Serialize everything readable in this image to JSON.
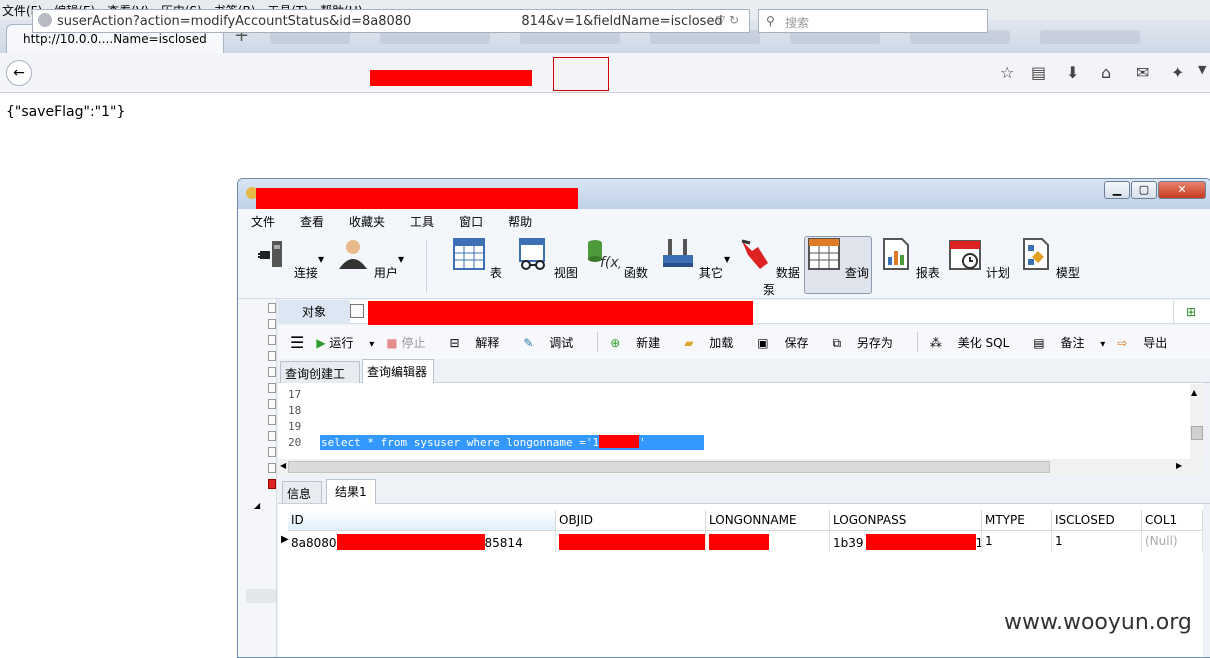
{
  "browser": {
    "menu": [
      "文件(F)",
      "编辑(E)",
      "查看(V)",
      "历史(S)",
      "书签(B)",
      "工具(T)",
      "帮助(H)"
    ],
    "tab_title": "http://10.0.0....Name=isclosed",
    "url_part1": "suserAction?action=modifyAccountStatus&id=8a8080",
    "url_part2": "814",
    "url_part3": "&v=1&fieldName=isclosed",
    "search_placeholder": "搜索",
    "page_text": "{\"saveFlag\":\"1\"}"
  },
  "navicat": {
    "menu": [
      "文件",
      "查看",
      "收藏夹",
      "工具",
      "窗口",
      "帮助"
    ],
    "toolbar": [
      {
        "label": "连接",
        "icon": "plug-icon"
      },
      {
        "label": "用户",
        "icon": "user-icon"
      },
      {
        "label": "表",
        "icon": "table-icon"
      },
      {
        "label": "视图",
        "icon": "view-icon"
      },
      {
        "label": "函数",
        "icon": "function-icon"
      },
      {
        "label": "其它",
        "icon": "tools-icon"
      },
      {
        "label": "数据泵",
        "icon": "pump-icon"
      },
      {
        "label": "查询",
        "icon": "query-icon"
      },
      {
        "label": "报表",
        "icon": "report-icon"
      },
      {
        "label": "计划",
        "icon": "calendar-icon"
      },
      {
        "label": "模型",
        "icon": "model-icon"
      }
    ],
    "object_tab": "对象",
    "query_toolbar": {
      "run": "运行",
      "stop": "停止",
      "explain": "解释",
      "debug": "调试",
      "new": "新建",
      "load": "加载",
      "save": "保存",
      "save_as": "另存为",
      "beautify": "美化 SQL",
      "memo": "备注",
      "export": "导出"
    },
    "query_tabs": [
      "查询创建工具",
      "查询编辑器"
    ],
    "line_numbers": [
      "17",
      "18",
      "19",
      "20"
    ],
    "sql_before": "select * from sysuser where longonname ='1",
    "sql_after": "'",
    "result_tabs": [
      "信息",
      "结果1"
    ],
    "columns": [
      "ID",
      "OBJID",
      "LONGONNAME",
      "LOGONPASS",
      "MTYPE",
      "ISCLOSED",
      "COL1"
    ],
    "row": {
      "id_start": "8a8080",
      "id_end": "85814",
      "logonpass_start": "1b39",
      "logonpass_end": "1:",
      "mtype": "1",
      "isclosed": "1",
      "col1": "(Null)"
    }
  },
  "watermark": "www.wooyun.org"
}
